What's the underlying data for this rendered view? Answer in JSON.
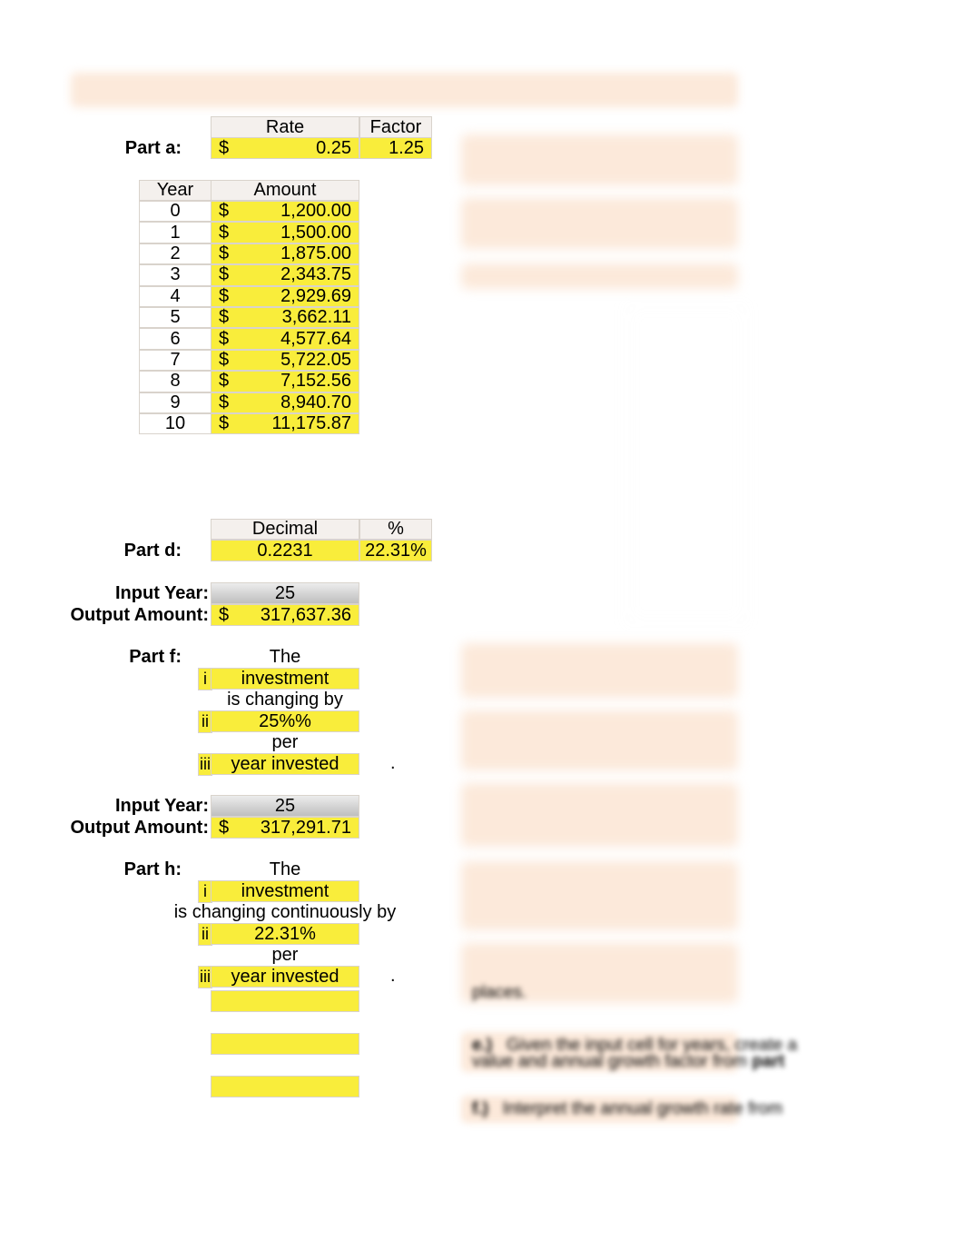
{
  "partA": {
    "label": "Part a:",
    "rateHeader": "Rate",
    "factorHeader": "Factor",
    "rate": "0.25",
    "factor": "1.25"
  },
  "amountTable": {
    "yearHeader": "Year",
    "amountHeader": "Amount",
    "rows": [
      {
        "year": "0",
        "amount": "1,200.00"
      },
      {
        "year": "1",
        "amount": "1,500.00"
      },
      {
        "year": "2",
        "amount": "1,875.00"
      },
      {
        "year": "3",
        "amount": "2,343.75"
      },
      {
        "year": "4",
        "amount": "2,929.69"
      },
      {
        "year": "5",
        "amount": "3,662.11"
      },
      {
        "year": "6",
        "amount": "4,577.64"
      },
      {
        "year": "7",
        "amount": "5,722.05"
      },
      {
        "year": "8",
        "amount": "7,152.56"
      },
      {
        "year": "9",
        "amount": "8,940.70"
      },
      {
        "year": "10",
        "amount": "11,175.87"
      }
    ]
  },
  "partD": {
    "label": "Part d:",
    "decimalHeader": "Decimal",
    "pctHeader": "%",
    "decimal": "0.2231",
    "pct": "22.31%"
  },
  "inputYearLabel": "Input Year:",
  "outputAmountLabel": "Output Amount:",
  "inputYear1": "25",
  "outputAmount1": "317,637.36",
  "partF": {
    "label": "Part f:",
    "the": "The",
    "i": "i",
    "iVal": "investment",
    "changing": "is changing by",
    "ii": "ii",
    "iiVal": "25%%",
    "per": "per",
    "iii": "iii",
    "iiiVal": "year invested"
  },
  "inputYear2": "25",
  "outputAmount2": "317,291.71",
  "partH": {
    "label": "Part h:",
    "the": "The",
    "i": "i",
    "iVal": "investment",
    "changing": "is changing continuously by",
    "ii": "ii",
    "iiVal": "22.31%",
    "per": "per",
    "iii": "iii",
    "iiiVal": "year invested"
  },
  "right": {
    "places": "places.",
    "e1": "e.)",
    "e2": "Given the input cell for years, create a",
    "e3": "value and annual growth factor from",
    "e4": "part",
    "f1": "f.)",
    "f2": "Interpret the annual growth rate from"
  },
  "dollar": "$",
  "period": "."
}
